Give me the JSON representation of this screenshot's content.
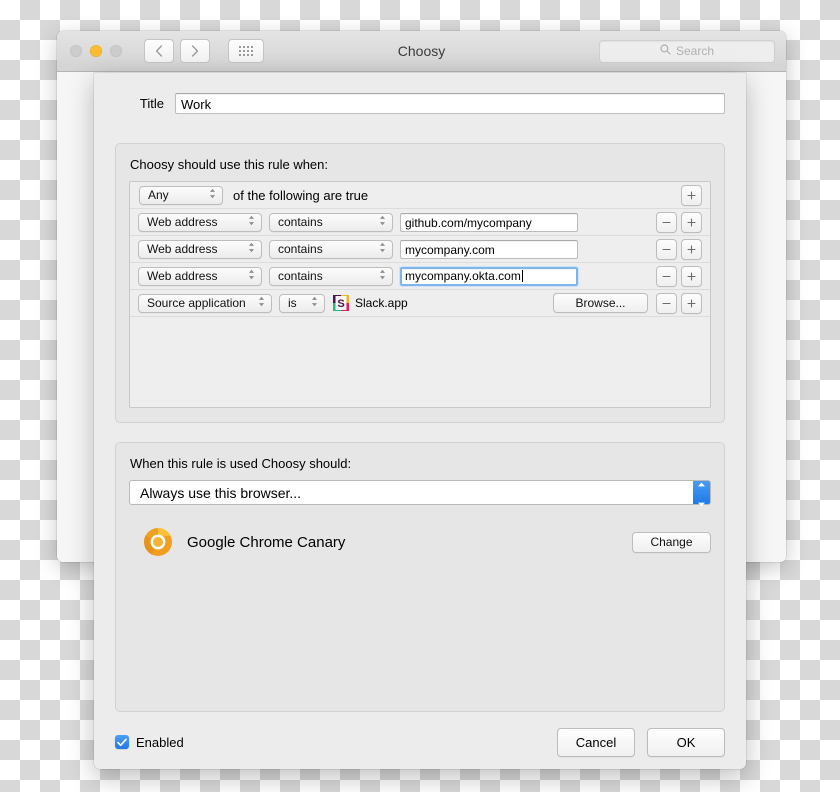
{
  "window": {
    "title": "Choosy",
    "traffic_lights": [
      "close-button",
      "minimize-button",
      "zoom-button"
    ],
    "nav_back_icon": "chevron-left-icon",
    "nav_forward_icon": "chevron-right-icon",
    "grid_icon": "show-all-icon",
    "search": {
      "placeholder": "Search",
      "icon": "search-icon",
      "value": ""
    }
  },
  "sheet": {
    "title_field": {
      "label": "Title",
      "value": "Work",
      "placeholder": ""
    },
    "conditions": {
      "heading": "Choosy should use this rule when:",
      "match_mode": "Any",
      "match_suffix": "of the following are true",
      "add_all_label": "+",
      "rows": [
        {
          "attribute": "Web address",
          "operator": "contains",
          "value": "github.com/mycompany",
          "kind": "text",
          "focused": false,
          "remove_label": "−",
          "add_label": "+"
        },
        {
          "attribute": "Web address",
          "operator": "contains",
          "value": "mycompany.com",
          "kind": "text",
          "focused": false,
          "remove_label": "−",
          "add_label": "+"
        },
        {
          "attribute": "Web address",
          "operator": "contains",
          "value": "mycompany.okta.com",
          "kind": "text",
          "focused": true,
          "remove_label": "−",
          "add_label": "+"
        },
        {
          "attribute": "Source application",
          "operator": "is",
          "value": "Slack.app",
          "kind": "app",
          "app_icon": "slack-app-icon",
          "browse_label": "Browse...",
          "focused": false,
          "remove_label": "−",
          "add_label": "+"
        }
      ]
    },
    "action": {
      "heading": "When this rule is used Choosy should:",
      "selected_action": "Always use this browser...",
      "browser": {
        "name": "Google Chrome Canary",
        "icon": "chrome-canary-icon",
        "change_label": "Change"
      }
    },
    "footer": {
      "enabled_label": "Enabled",
      "enabled_checked": true,
      "cancel_label": "Cancel",
      "ok_label": "OK"
    }
  },
  "colors": {
    "accent_blue": "#2179e8",
    "focus_ring": "#7eb5ef",
    "amber_light": "#fdbc2f",
    "sheet_bg": "#ececec",
    "group_bg": "#e6e6e6",
    "list_bg": "#eeeeee"
  }
}
